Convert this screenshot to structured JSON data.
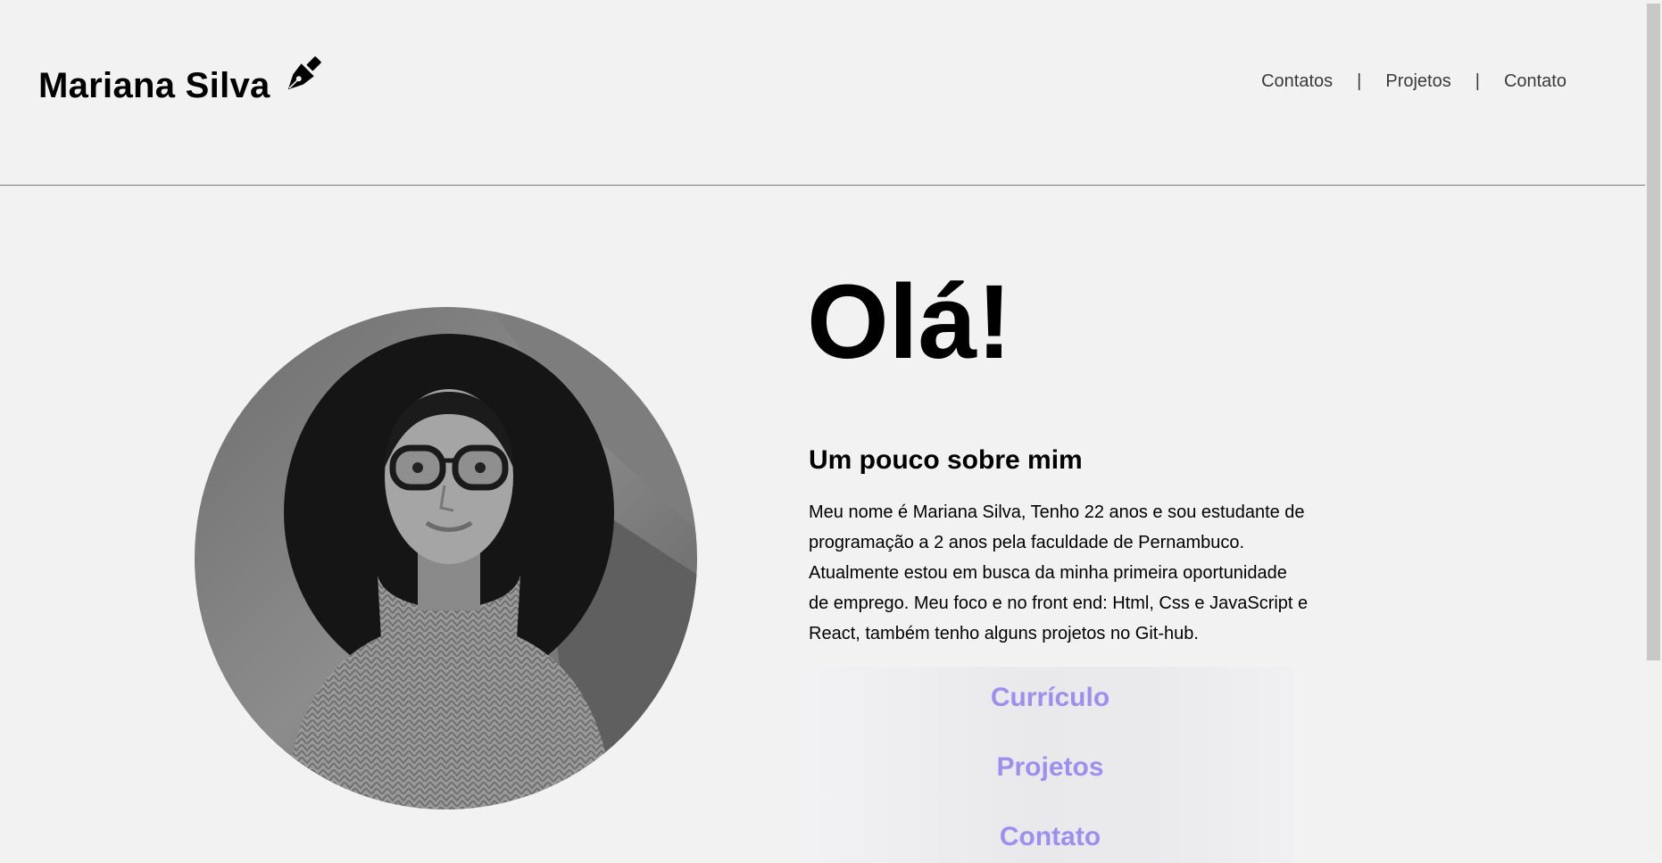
{
  "header": {
    "brand_name": "Mariana Silva",
    "brand_icon": "fountain-pen-icon",
    "nav": [
      {
        "label": "Contatos"
      },
      {
        "label": "Projetos"
      },
      {
        "label": "Contato"
      }
    ],
    "separator": "|"
  },
  "hero": {
    "greeting": "Olá!",
    "about_title": "Um pouco sobre mim",
    "about_text": "Meu nome é Mariana Silva, Tenho 22 anos e sou estudante de programação a 2 anos pela faculdade de Pernambuco. Atualmente estou em busca da minha primeira oportunidade de emprego. Meu foco e no front end: Html, Css e JavaScript e React, também tenho alguns projetos no Git-hub.",
    "links": [
      {
        "label": "Currículo"
      },
      {
        "label": "Projetos"
      },
      {
        "label": "Contato"
      }
    ]
  },
  "colors": {
    "background": "#f2f2f2",
    "link_accent": "#9c8ff0",
    "nav_text": "#3a3a3a"
  }
}
